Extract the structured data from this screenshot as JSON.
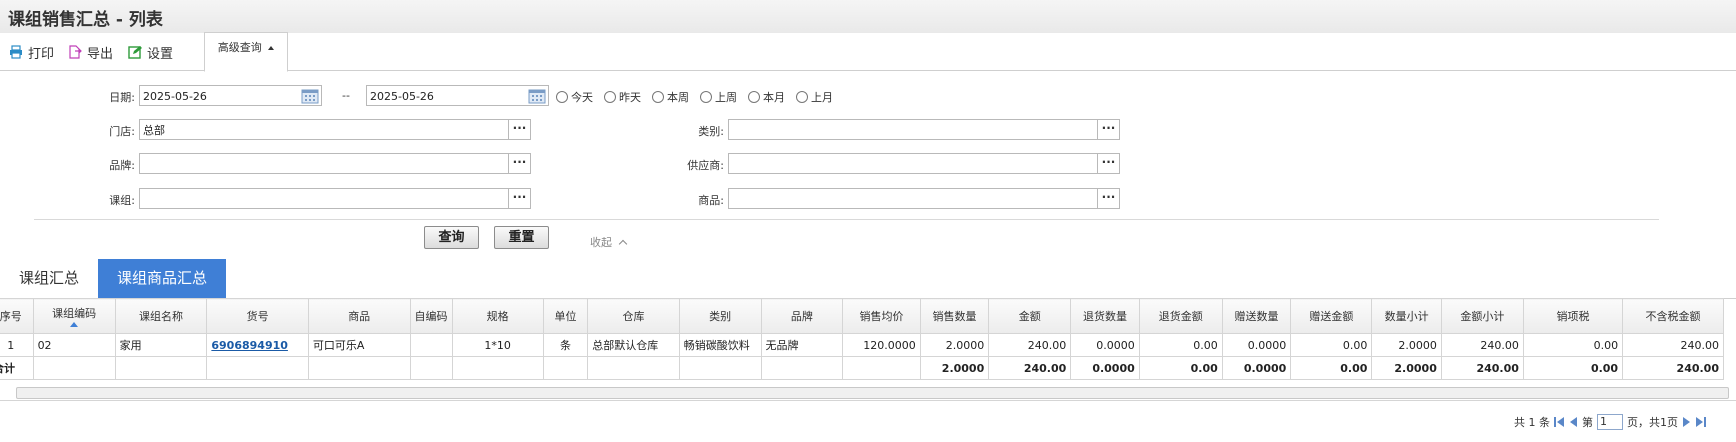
{
  "page": {
    "title": "课组销售汇总 - 列表"
  },
  "toolbar": {
    "print": "打印",
    "export": "导出",
    "settings": "设置",
    "advanced_query": "高级查询"
  },
  "colors": {
    "accent": "#3f7fd6",
    "print_icon": "#2b8cc6",
    "export_icon": "#c040b8",
    "settings_icon": "#2e9b3a"
  },
  "form": {
    "date_label": "日期:",
    "date_from": "2025-05-26",
    "date_sep": "--",
    "date_to": "2025-05-26",
    "quick_dates": [
      "今天",
      "昨天",
      "本周",
      "上周",
      "本月",
      "上月"
    ],
    "store_label": "门店:",
    "store_value": "总部",
    "category_label": "类别:",
    "category_value": "",
    "brand_label": "品牌:",
    "brand_value": "",
    "supplier_label": "供应商:",
    "supplier_value": "",
    "group_label": "课组:",
    "group_value": "",
    "product_label": "商品:",
    "product_value": "",
    "query_button": "查询",
    "reset_button": "重置",
    "collapse": "收起"
  },
  "tabs": [
    {
      "label": "课组汇总",
      "active": false
    },
    {
      "label": "课组商品汇总",
      "active": true
    }
  ],
  "table": {
    "columns": [
      "序号",
      "课组编码",
      "课组名称",
      "货号",
      "商品",
      "自编码",
      "规格",
      "单位",
      "仓库",
      "类别",
      "品牌",
      "销售均价",
      "销售数量",
      "金额",
      "退货数量",
      "退货金额",
      "赠送数量",
      "赠送金额",
      "数量小计",
      "金额小计",
      "销项税",
      "不含税金额"
    ],
    "rows": [
      [
        "1",
        "02",
        "家用",
        "6906894910",
        "可口可乐A",
        "",
        "1*10",
        "条",
        "总部默认仓库",
        "畅销碳酸饮料",
        "无品牌",
        "120.0000",
        "2.0000",
        "240.00",
        "0.0000",
        "0.00",
        "0.0000",
        "0.00",
        "2.0000",
        "240.00",
        "0.00",
        "240.00"
      ]
    ],
    "total": [
      "合计",
      "",
      "",
      "",
      "",
      "",
      "",
      "",
      "",
      "",
      "",
      "",
      "2.0000",
      "240.00",
      "0.0000",
      "0.00",
      "0.0000",
      "0.00",
      "2.0000",
      "240.00",
      "0.00",
      "240.00"
    ]
  },
  "pager": {
    "total": "共 1 条",
    "page_prefix": "第",
    "page": "1",
    "page_suffix": "页，共1页"
  }
}
